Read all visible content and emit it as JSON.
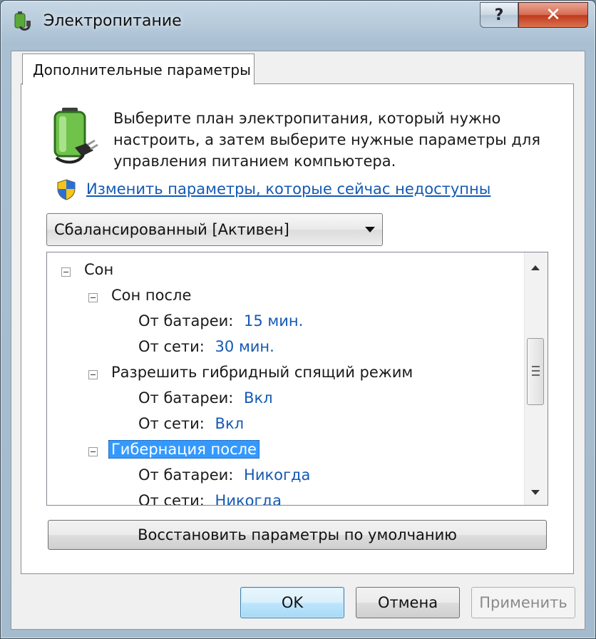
{
  "window": {
    "title": "Электропитание",
    "help_label": "?",
    "close_label": "✕"
  },
  "tab": {
    "label": "Дополнительные параметры"
  },
  "description": "Выберите план электропитания, который нужно настроить, а затем выберите нужные параметры для управления питанием компьютера.",
  "change_link": "Изменить параметры, которые сейчас недоступны",
  "plan_select": {
    "value": "Сбалансированный [Активен]"
  },
  "tree": {
    "sleep": "Сон",
    "sleep_after": {
      "label": "Сон после",
      "battery_label": "От батареи:",
      "battery_value": "15 мин.",
      "ac_label": "От сети:",
      "ac_value": "30 мин."
    },
    "hybrid": {
      "label": "Разрешить гибридный спящий режим",
      "battery_label": "От батареи:",
      "battery_value": "Вкл",
      "ac_label": "От сети:",
      "ac_value": "Вкл"
    },
    "hibernate": {
      "label": "Гибернация после",
      "battery_label": "От батареи:",
      "battery_value": "Никогда",
      "ac_label": "От сети:",
      "ac_value": "Никогда"
    }
  },
  "restore_label": "Восстановить параметры по умолчанию",
  "buttons": {
    "ok": "OK",
    "cancel": "Отмена",
    "apply": "Применить"
  },
  "colors": {
    "link": "#1459b4",
    "selection": "#3399ff"
  }
}
